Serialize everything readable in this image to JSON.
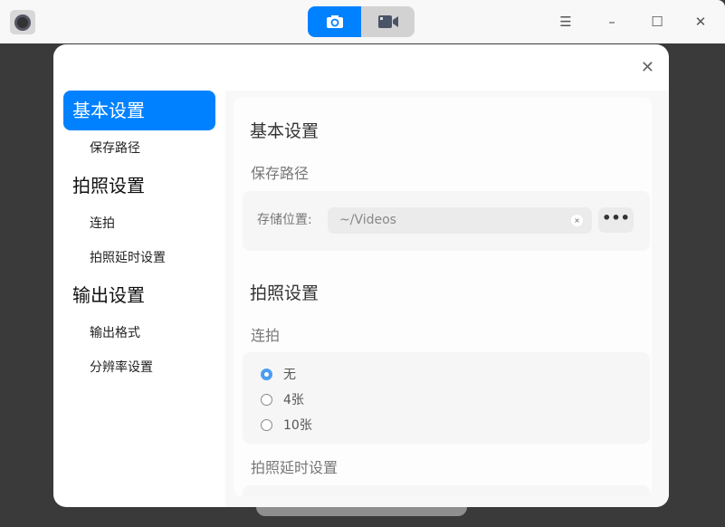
{
  "titlebar": {
    "modes": [
      {
        "name": "photo",
        "icon": "camera-icon",
        "active": true
      },
      {
        "name": "video",
        "icon": "video-icon",
        "active": false
      }
    ],
    "menu_icon": "☰",
    "min_icon": "–",
    "max_icon": "☐",
    "close_icon": "✕"
  },
  "dialog": {
    "close_icon": "✕",
    "nav": [
      {
        "label": "基本设置",
        "level": 1,
        "selected": true
      },
      {
        "label": "保存路径",
        "level": 2
      },
      {
        "label": "拍照设置",
        "level": 1
      },
      {
        "label": "连拍",
        "level": 2
      },
      {
        "label": "拍照延时设置",
        "level": 2
      },
      {
        "label": "输出设置",
        "level": 1
      },
      {
        "label": "输出格式",
        "level": 2
      },
      {
        "label": "分辨率设置",
        "level": 2
      }
    ],
    "basic_title": "基本设置",
    "save_path_title": "保存路径",
    "storage_label": "存储位置:",
    "storage_value": "~/Videos",
    "clear_icon": "×",
    "browse_label": "•••",
    "photo_title": "拍照设置",
    "burst_title": "连拍",
    "burst_options": [
      {
        "label": "无",
        "checked": true
      },
      {
        "label": "4张",
        "checked": false
      },
      {
        "label": "10张",
        "checked": false
      }
    ],
    "delay_title": "拍照延时设置"
  },
  "accent": "#0081ff"
}
